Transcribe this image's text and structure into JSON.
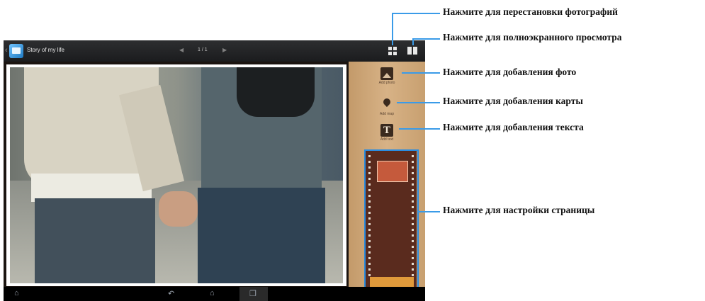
{
  "app": {
    "title": "Story of my life",
    "page_indicator": "1 / 1",
    "prev_icon": "◀",
    "next_icon": "▶",
    "back_caret": "‹"
  },
  "tools": {
    "add_photo": "Add photo",
    "add_map": "Add map",
    "add_text": "Add text",
    "text_glyph": "T"
  },
  "navbar": {
    "home_glyph": "⌂",
    "back_glyph": "↶",
    "home2_glyph": "⌂",
    "recent_glyph": "❐"
  },
  "callouts": {
    "rearrange": "Нажмите для перестановки фотографий",
    "fullscreen": "Нажмите для полноэкранного просмотра",
    "add_photo": "Нажмите для добавления фото",
    "add_map": "Нажмите для добавления карты",
    "add_text": "Нажмите для добавления текста",
    "page_settings": "Нажмите для настройки страницы"
  },
  "colors": {
    "callout_line": "#3a9be8",
    "panel_wood": "#d7b286",
    "film": "#5a2b1e"
  }
}
